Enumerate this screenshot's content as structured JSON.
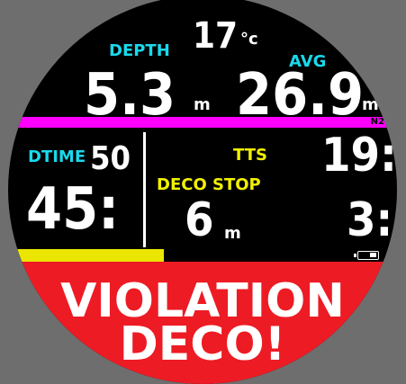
{
  "top": {
    "temperature_value": "17",
    "temperature_unit": "°c",
    "depth_label": "DEPTH",
    "depth_value": "5.3",
    "depth_unit": "m",
    "avg_label": "AVG",
    "avg_value": "26.9",
    "avg_unit": "m"
  },
  "n2_bar": {
    "label": "N2",
    "color": "#ff00ff"
  },
  "middle": {
    "dtime_label": "DTIME",
    "dtime_value": "50",
    "dtime_main": "45:",
    "tts_label": "TTS",
    "tts_value": "19:",
    "deco_stop_label": "DECO STOP",
    "deco_stop_value": "6",
    "deco_stop_unit": "m",
    "deco_stop_time": "3:"
  },
  "cns_bar": {
    "fill_fraction": 0.4,
    "color": "#ebe600",
    "battery_icon": "battery-icon"
  },
  "warning": {
    "line1": "VIOLATION",
    "line2": "DECO!",
    "color": "#ed1b24"
  }
}
